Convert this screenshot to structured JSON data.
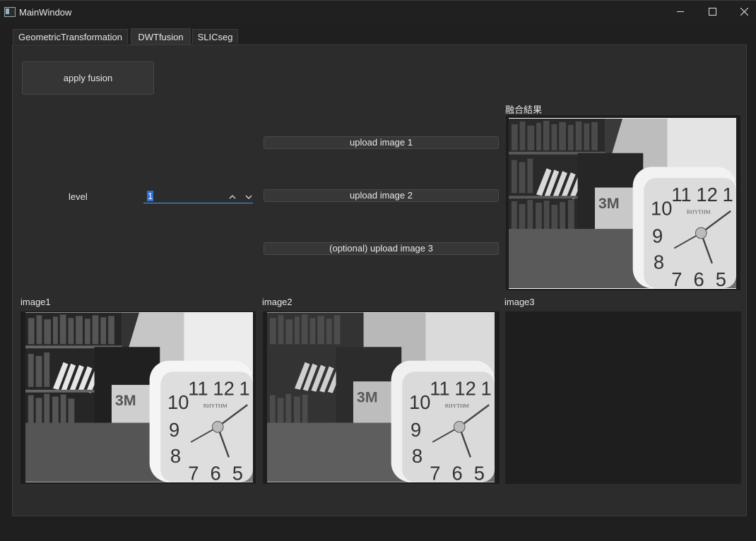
{
  "window": {
    "title": "MainWindow",
    "controls": [
      "minimize",
      "maximize",
      "close"
    ]
  },
  "tabs": [
    {
      "label": "GeometricTransformation",
      "active": false
    },
    {
      "label": "DWTfusion",
      "active": true
    },
    {
      "label": "SLICseg",
      "active": false
    }
  ],
  "controls": {
    "apply_label": "apply fusion",
    "level_label": "level",
    "level_value": "1",
    "upload1_label": "upload image 1",
    "upload2_label": "upload image 2",
    "upload3_label": "(optional) upload image 3"
  },
  "captions": {
    "result": "融合結果",
    "image1": "image1",
    "image2": "image2",
    "image3": "image3"
  },
  "icons": {
    "app": "app-window-icon",
    "spin_up": "chevron-up-icon",
    "spin_down": "chevron-down-icon"
  },
  "colors": {
    "background": "#1f1f1f",
    "panel": "#2c2c2c",
    "accent": "#4c9be8",
    "selection": "#2f6fd6"
  }
}
